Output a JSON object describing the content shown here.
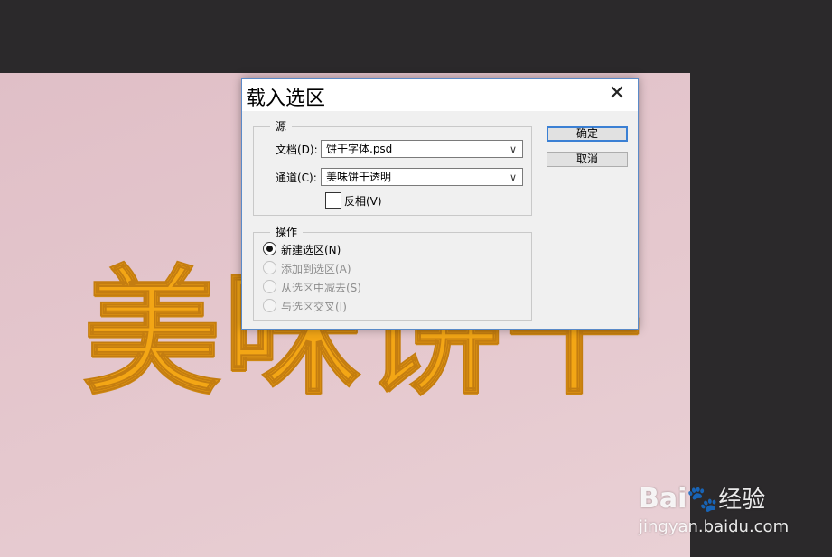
{
  "canvas": {
    "artwork_text": "美味饼干"
  },
  "dialog": {
    "title": "载入选区",
    "close_glyph": "✕",
    "source": {
      "legend": "源",
      "document_label": "文档(D):",
      "document_value": "饼干字体.psd",
      "channel_label": "通道(C):",
      "channel_value": "美味饼干透明",
      "invert_label": "反相(V)",
      "invert_checked": false
    },
    "operation": {
      "legend": "操作",
      "options": [
        {
          "label": "新建选区(N)",
          "selected": true,
          "enabled": true
        },
        {
          "label": "添加到选区(A)",
          "selected": false,
          "enabled": false
        },
        {
          "label": "从选区中减去(S)",
          "selected": false,
          "enabled": false
        },
        {
          "label": "与选区交叉(I)",
          "selected": false,
          "enabled": false
        }
      ]
    },
    "ok_label": "确定",
    "cancel_label": "取消"
  },
  "watermark": {
    "brand": "Bai",
    "brand_suffix": "经验",
    "url": "jingyan.baidu.com"
  }
}
